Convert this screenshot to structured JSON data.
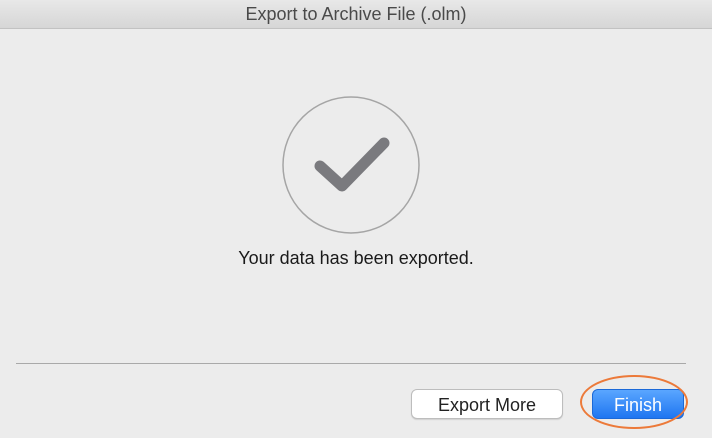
{
  "window": {
    "title": "Export to Archive File (.olm)"
  },
  "main": {
    "status_message": "Your data has been exported.",
    "status_icon": "checkmark-circle-icon"
  },
  "footer": {
    "export_more_label": "Export More",
    "finish_label": "Finish"
  },
  "colors": {
    "primary_button": "#1f76f1",
    "highlight_ring": "#ec7a3a",
    "checkmark": "#7a7a7e"
  }
}
